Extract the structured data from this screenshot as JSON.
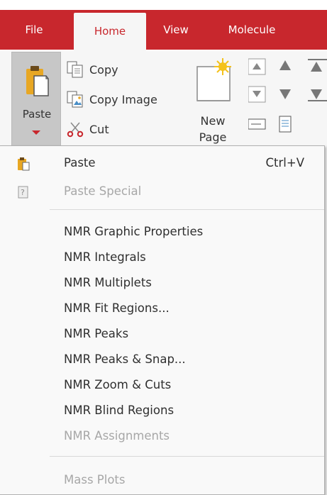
{
  "menubar": {
    "tabs": [
      {
        "label": "File"
      },
      {
        "label": "Home",
        "active": true
      },
      {
        "label": "View"
      },
      {
        "label": "Molecule"
      }
    ],
    "accent_color": "#c8272d"
  },
  "ribbon": {
    "paste_label": "Paste",
    "copy_label": "Copy",
    "copy_image_label": "Copy Image",
    "cut_label": "Cut",
    "new_page_line1": "New",
    "new_page_line2": "Page"
  },
  "paste_menu": {
    "items": [
      {
        "label": "Paste",
        "shortcut": "Ctrl+V",
        "icon": "paste-icon",
        "enabled": true
      },
      {
        "label": "Paste Special",
        "icon": "paste-special-icon",
        "enabled": false
      },
      {
        "label": "NMR Graphic Properties",
        "enabled": true
      },
      {
        "label": "NMR Integrals",
        "enabled": true
      },
      {
        "label": "NMR Multiplets",
        "enabled": true
      },
      {
        "label": "NMR Fit Regions...",
        "enabled": true
      },
      {
        "label": "NMR Peaks",
        "enabled": true
      },
      {
        "label": "NMR Peaks & Snap...",
        "enabled": true
      },
      {
        "label": "NMR Zoom & Cuts",
        "enabled": true
      },
      {
        "label": "NMR Blind Regions",
        "enabled": true
      },
      {
        "label": "NMR Assignments",
        "enabled": false
      },
      {
        "label": "Mass Plots",
        "enabled": false
      }
    ]
  }
}
